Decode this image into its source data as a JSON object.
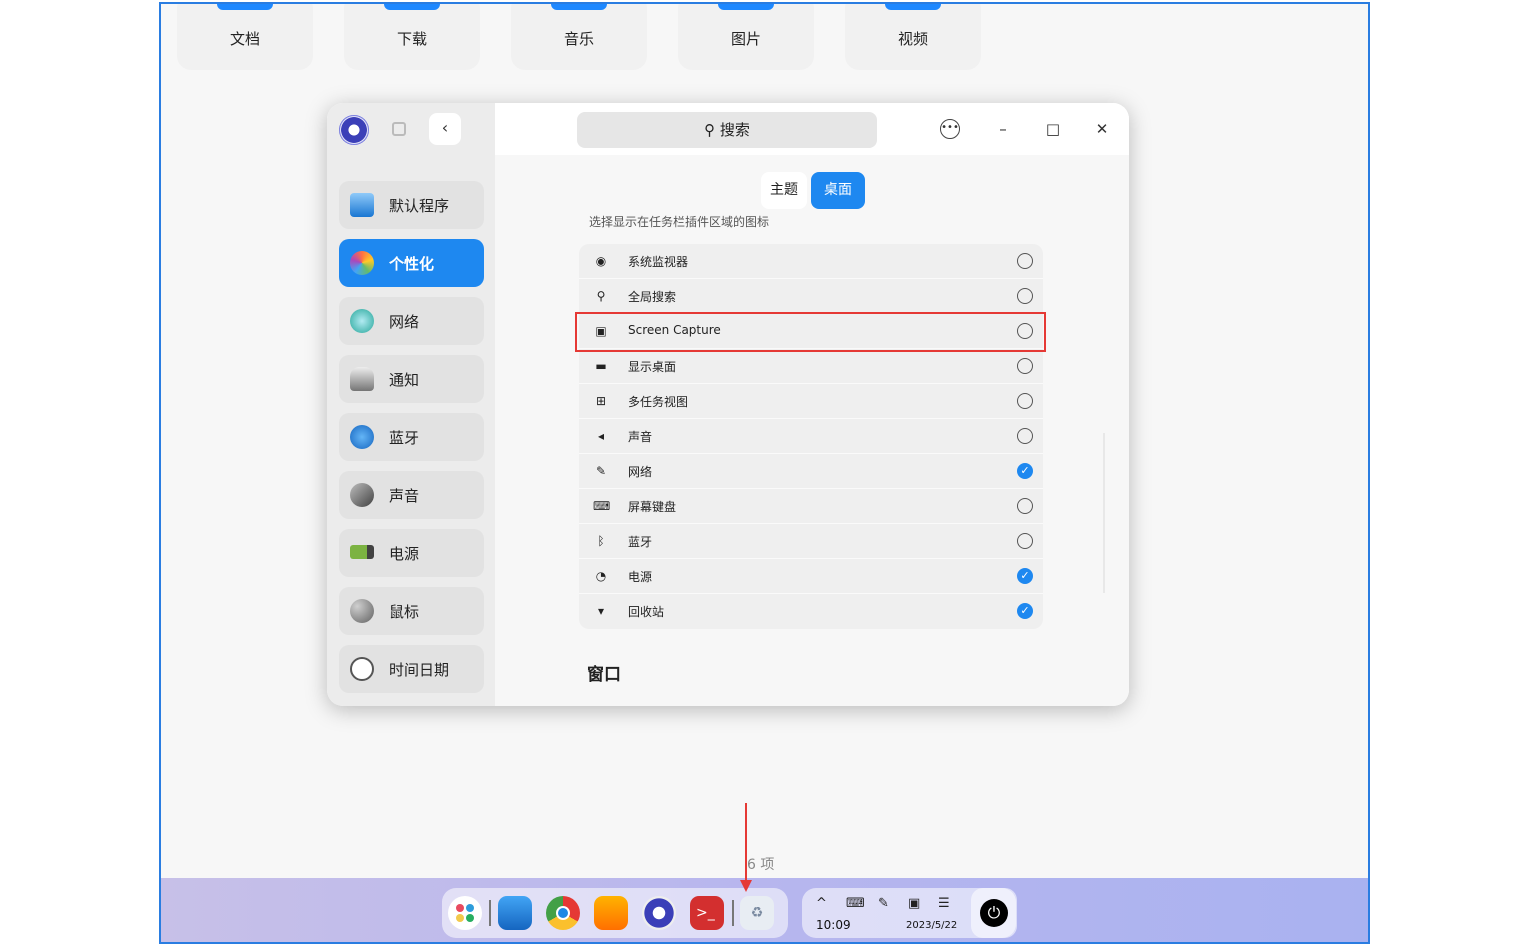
{
  "desktop": {
    "folders": [
      "文档",
      "下载",
      "音乐",
      "图片",
      "视频"
    ],
    "item_count": "6 项"
  },
  "settings": {
    "sidebar": {
      "items": [
        {
          "label": "默认程序",
          "icon": "default-apps-icon",
          "active": false
        },
        {
          "label": "个性化",
          "icon": "personalization-icon",
          "active": true
        },
        {
          "label": "网络",
          "icon": "network-icon",
          "active": false
        },
        {
          "label": "通知",
          "icon": "bell-icon",
          "active": false
        },
        {
          "label": "蓝牙",
          "icon": "bluetooth-icon",
          "active": false
        },
        {
          "label": "声音",
          "icon": "speaker-icon",
          "active": false
        },
        {
          "label": "电源",
          "icon": "battery-icon",
          "active": false
        },
        {
          "label": "鼠标",
          "icon": "mouse-icon",
          "active": false
        },
        {
          "label": "时间日期",
          "icon": "clock-icon",
          "active": false
        }
      ]
    },
    "search": {
      "placeholder": "搜索"
    },
    "tabs": {
      "theme": "主题",
      "desktop": "桌面"
    },
    "section_desc": "选择显示在任务栏插件区域的图标",
    "plugins": [
      {
        "label": "系统监视器",
        "icon": "system-monitor-icon",
        "checked": false
      },
      {
        "label": "全局搜索",
        "icon": "search-icon",
        "checked": false
      },
      {
        "label": "Screen Capture",
        "icon": "screen-capture-icon",
        "checked": false
      },
      {
        "label": "显示桌面",
        "icon": "show-desktop-icon",
        "checked": false
      },
      {
        "label": "多任务视图",
        "icon": "multitask-view-icon",
        "checked": false
      },
      {
        "label": "声音",
        "icon": "speaker-icon",
        "checked": false
      },
      {
        "label": "网络",
        "icon": "network-icon",
        "checked": true
      },
      {
        "label": "屏幕键盘",
        "icon": "keyboard-icon",
        "checked": false
      },
      {
        "label": "蓝牙",
        "icon": "bluetooth-icon",
        "checked": false
      },
      {
        "label": "电源",
        "icon": "power-icon",
        "checked": true
      },
      {
        "label": "回收站",
        "icon": "trash-icon",
        "checked": true
      }
    ],
    "window_heading": "窗口"
  },
  "taskbar": {
    "time": "10:09",
    "date": "2023/5/22"
  },
  "colors": {
    "accent": "#1e88f0",
    "highlight": "#e53935",
    "taskbar_start": "#c7c0e8",
    "taskbar_end": "#a9b2f0"
  }
}
